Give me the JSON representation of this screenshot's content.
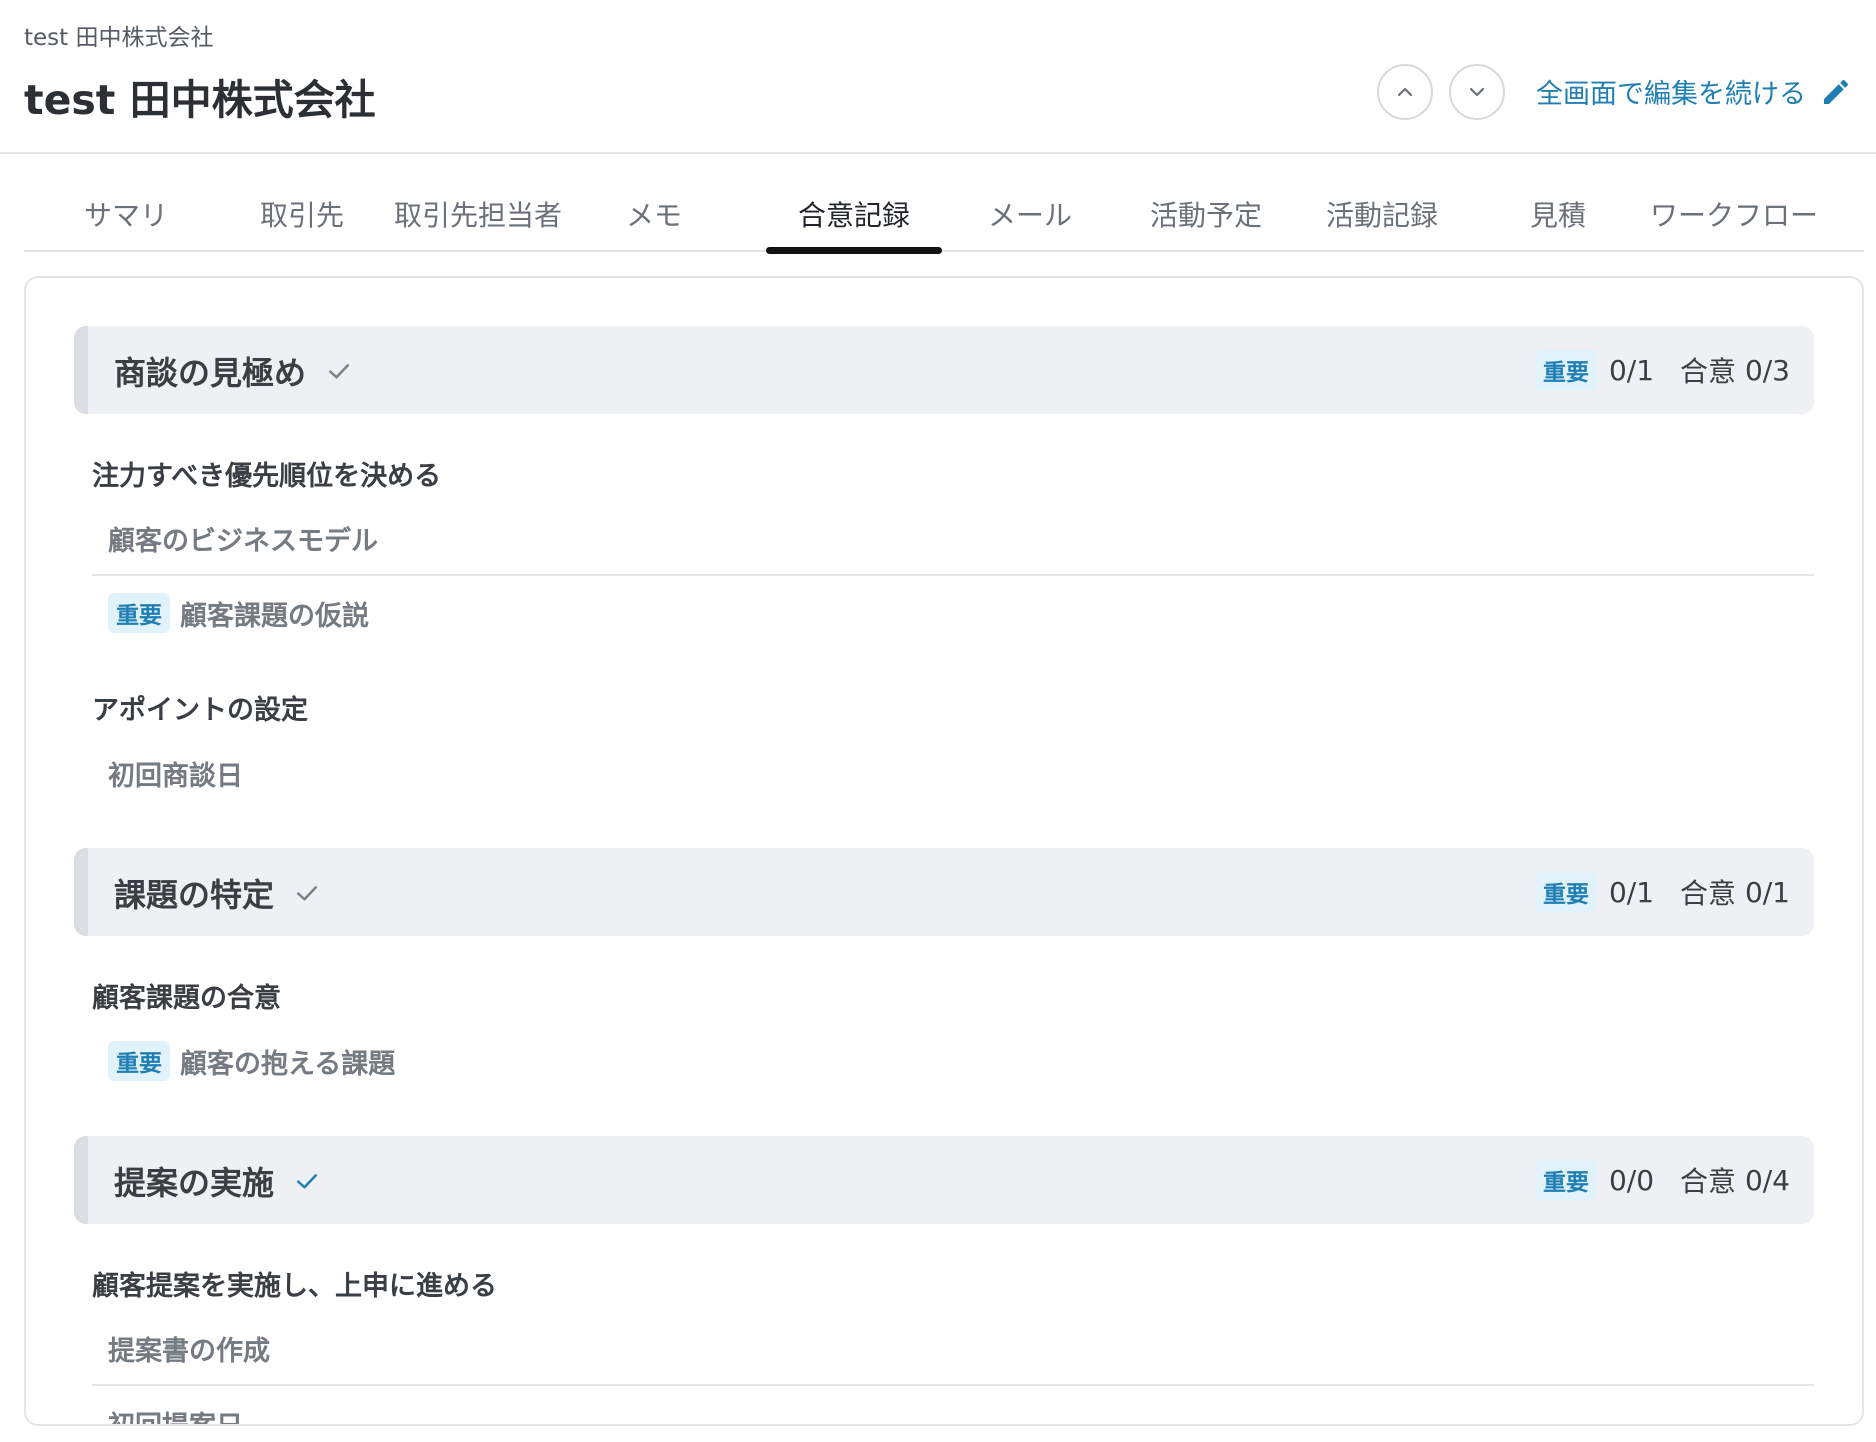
{
  "header": {
    "breadcrumb": "test 田中株式会社",
    "title": "test 田中株式会社",
    "edit_label": "全画面で編集を続ける"
  },
  "tabs": [
    {
      "label": "サマリ"
    },
    {
      "label": "取引先"
    },
    {
      "label": "取引先担当者"
    },
    {
      "label": "メモ"
    },
    {
      "label": "合意記録",
      "active": true
    },
    {
      "label": "メール"
    },
    {
      "label": "活動予定"
    },
    {
      "label": "活動記録"
    },
    {
      "label": "見積"
    },
    {
      "label": "ワークフロー"
    }
  ],
  "badge_label": "重要",
  "sections": [
    {
      "title": "商談の見極め",
      "important_label": "重要",
      "important_count": "0/1",
      "agree_label": "合意",
      "agree_count": "0/3",
      "check_color": "#7b8188",
      "groups": [
        {
          "title": "注力すべき優先順位を決める",
          "items": [
            "顧客のビジネスモデル",
            "顧客課題の仮説"
          ]
        },
        {
          "title": "アポイントの設定",
          "items": [
            "初回商談日"
          ]
        }
      ]
    },
    {
      "title": "課題の特定",
      "important_label": "重要",
      "important_count": "0/1",
      "agree_label": "合意",
      "agree_count": "0/1",
      "check_color": "#7b8188",
      "groups": [
        {
          "title": "顧客課題の合意",
          "items": [
            "顧客の抱える課題"
          ]
        }
      ]
    },
    {
      "title": "提案の実施",
      "important_label": "重要",
      "important_count": "0/0",
      "agree_label": "合意",
      "agree_count": "0/4",
      "check_color": "#1f7fb3",
      "groups": [
        {
          "title": "顧客提案を実施し、上申に進める",
          "items": [
            "提案書の作成",
            "初回提案日"
          ]
        }
      ]
    }
  ],
  "colors": {
    "accent": "#1f7fb3",
    "badge_bg": "#e2f2fa",
    "section_bg": "#eef0f3",
    "border": "#e3e5e8"
  },
  "icons": [
    "chevron-up-icon",
    "chevron-down-icon",
    "pencil-icon",
    "check-icon"
  ]
}
